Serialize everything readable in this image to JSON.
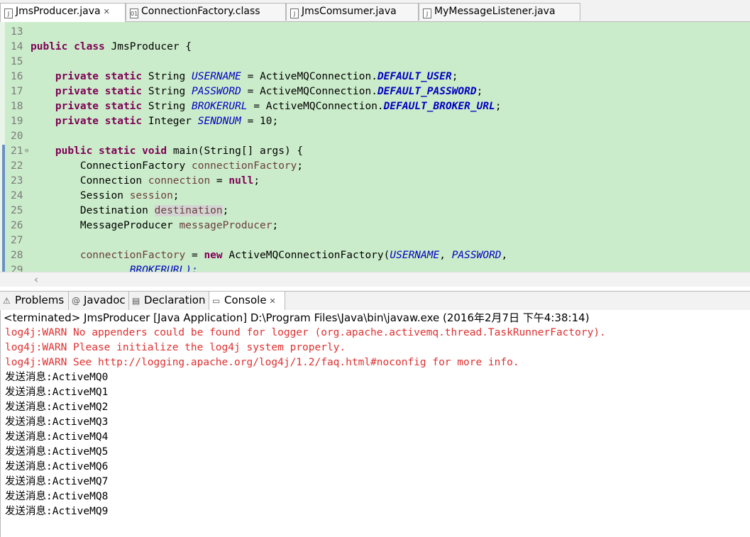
{
  "editor_tabs": [
    {
      "label": "JmsProducer.java",
      "active": true,
      "icon": "java-file-icon",
      "closable": true
    },
    {
      "label": "ConnectionFactory.class",
      "active": false,
      "icon": "class-file-icon"
    },
    {
      "label": "JmsComsumer.java",
      "active": false,
      "icon": "java-file-icon"
    },
    {
      "label": "MyMessageListener.java",
      "active": false,
      "icon": "java-file-icon"
    }
  ],
  "code": {
    "ln": [
      "13",
      "14",
      "15",
      "16",
      "17",
      "18",
      "19",
      "20",
      "21",
      "22",
      "23",
      "24",
      "25",
      "26",
      "27",
      "28",
      "29"
    ],
    "kw_public": "public",
    "kw_class": "class",
    "kw_private": "private",
    "kw_static": "static",
    "kw_void": "void",
    "kw_null": "null",
    "kw_new": "new",
    "class_name": "JmsProducer {",
    "t_string": "String",
    "t_integer": "Integer",
    "f_username": "USERNAME",
    "f_password": "PASSWORD",
    "f_brokerurl": "BROKERURL",
    "f_sendnum": "SENDNUM",
    "amq_conn": "ActiveMQConnection.",
    "c_default_user": "DEFAULT_USER",
    "c_default_password": "DEFAULT_PASSWORD",
    "c_default_broker_url": "DEFAULT_BROKER_URL",
    "sendnum_val": " = 10;",
    "main_sig": "main(String[] args) {",
    "arg_name": "args",
    "t_connectionfactory": "ConnectionFactory",
    "t_connection": "Connection",
    "t_session": "Session",
    "t_destination": "Destination",
    "t_messageproducer": "MessageProducer",
    "v_connectionfactory": "connectionFactory",
    "v_connection": "connection",
    "v_session": "session",
    "v_destination": "destination",
    "v_messageproducer": "messageProducer",
    "amq_factory": "ActiveMQConnectionFactory(",
    "f_brokerurl_cont": "BROKERURL);"
  },
  "view_tabs": [
    {
      "label": "Problems",
      "icon": "problems-icon"
    },
    {
      "label": "Javadoc",
      "icon": "at-icon"
    },
    {
      "label": "Declaration",
      "icon": "declaration-icon"
    },
    {
      "label": "Console",
      "icon": "console-icon",
      "active": true
    }
  ],
  "console": {
    "header": "<terminated> JmsProducer [Java Application] D:\\Program Files\\Java\\bin\\javaw.exe (2016年2月7日 下午4:38:14)",
    "warnings": [
      "log4j:WARN No appenders could be found for logger (org.apache.activemq.thread.TaskRunnerFactory).",
      "log4j:WARN Please initialize the log4j system properly.",
      "log4j:WARN See http://logging.apache.org/log4j/1.2/faq.html#noconfig for more info."
    ],
    "output": [
      "发送消息:ActiveMQ0",
      "发送消息:ActiveMQ1",
      "发送消息:ActiveMQ2",
      "发送消息:ActiveMQ3",
      "发送消息:ActiveMQ4",
      "发送消息:ActiveMQ5",
      "发送消息:ActiveMQ6",
      "发送消息:ActiveMQ7",
      "发送消息:ActiveMQ8",
      "发送消息:ActiveMQ9"
    ]
  },
  "colors": {
    "editor_bg": "#cbeccb",
    "keyword": "#7f0055",
    "field": "#0000c0",
    "warning": "#e03030"
  }
}
